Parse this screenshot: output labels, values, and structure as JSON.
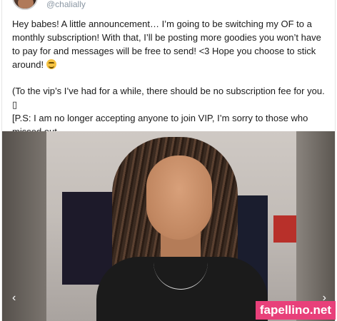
{
  "post": {
    "handle": "@chalially",
    "text_line1": "Hey babes! A little announcement… I’m going to be switching my OF to a monthly subscription! With that, I’ll be posting more goodies you won’t have to pay for and messages will be free to send! <3 Hope you choose to stick around!",
    "text_line2_a": "(To the vip’s I’ve had for a while, there should be no subscription fee for you. ▯",
    "text_line2_b": "[P.S: I am no longer accepting anyone to join VIP, I’m sorry to those who missed out.",
    "text_line2_c": "])",
    "emoji_icon": "grinning-sweat-emoji-icon",
    "heart_icon": "black-heart-icon"
  },
  "media": {
    "prev_glyph": "‹",
    "next_glyph": "›"
  },
  "watermark": {
    "text": "fapellino.net",
    "color": "#e8407a"
  }
}
